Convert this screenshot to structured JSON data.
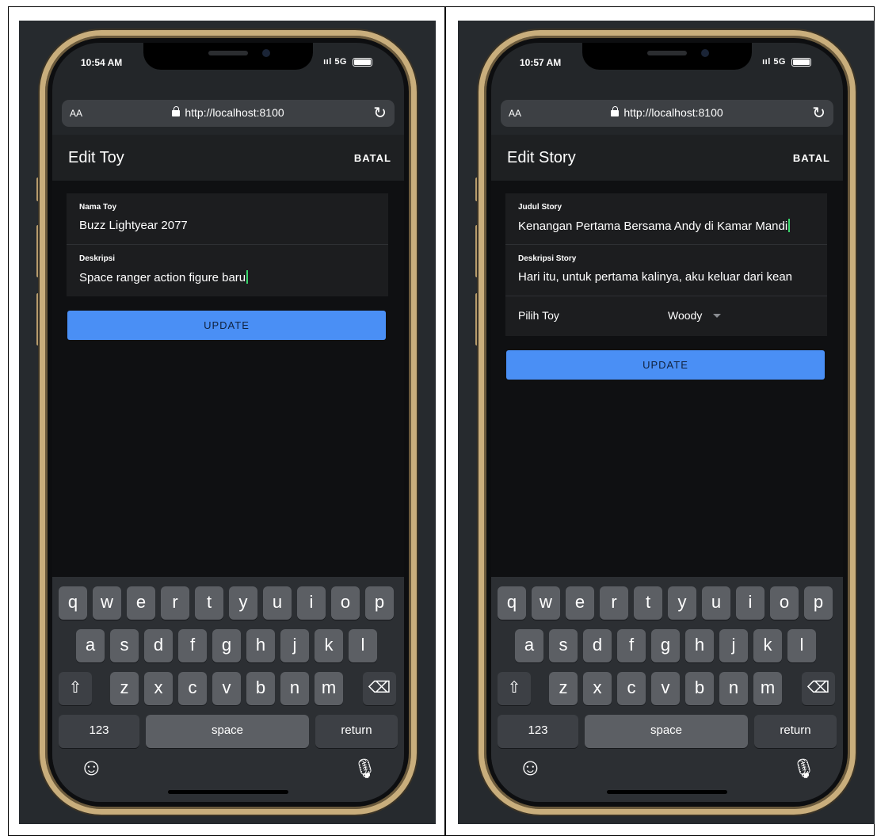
{
  "left": {
    "status": {
      "time": "10:54 AM",
      "signal": "ııl 5G"
    },
    "browser": {
      "aa": "AA",
      "url": "http://localhost:8100",
      "reload": "↻"
    },
    "page": {
      "title": "Edit Toy",
      "cancel": "BATAL"
    },
    "fields": [
      {
        "label": "Nama Toy",
        "value": "Buzz Lightyear 2077"
      },
      {
        "label": "Deskripsi",
        "value": "Space ranger action figure baru"
      }
    ],
    "update": "UPDATE"
  },
  "right": {
    "status": {
      "time": "10:57 AM",
      "signal": "ııl 5G"
    },
    "browser": {
      "aa": "AA",
      "url": "http://localhost:8100",
      "reload": "↻"
    },
    "page": {
      "title": "Edit Story",
      "cancel": "BATAL"
    },
    "fields": [
      {
        "label": "Judul Story",
        "value": "Kenangan Pertama Bersama Andy di Kamar Mandi"
      },
      {
        "label": "Deskripsi Story",
        "value": "Hari itu, untuk pertama kalinya, aku keluar dari kean"
      }
    ],
    "select": {
      "label": "Pilih Toy",
      "value": "Woody"
    },
    "update": "UPDATE"
  },
  "keyboard": {
    "row1": [
      "q",
      "w",
      "e",
      "r",
      "t",
      "y",
      "u",
      "i",
      "o",
      "p"
    ],
    "row2": [
      "a",
      "s",
      "d",
      "f",
      "g",
      "h",
      "j",
      "k",
      "l"
    ],
    "row3": [
      "z",
      "x",
      "c",
      "v",
      "b",
      "n",
      "m"
    ],
    "shift": "⇧",
    "backspace": "⌫",
    "numbers": "123",
    "space": "space",
    "return": "return",
    "emoji": "☺",
    "mic": "🎙"
  },
  "colors": {
    "accent": "#4a8ff5",
    "caret": "#3ad66c",
    "frame": "#c9ae7c"
  }
}
